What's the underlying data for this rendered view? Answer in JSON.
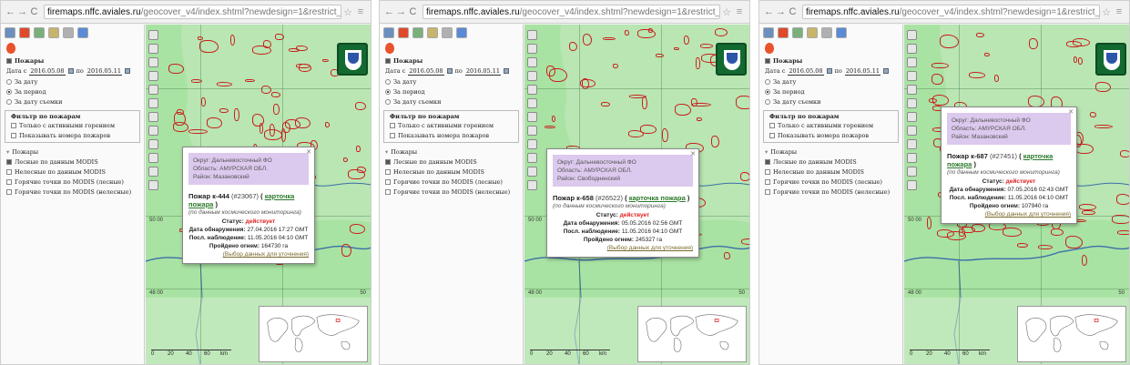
{
  "browser": {
    "url_domain": "firemaps.nffc.aviales.ru",
    "url_path": "/geocover_v4/index.shtml?newdesign=1&restrict_user=1"
  },
  "sidebar": {
    "fires_label": "Пожары",
    "date_from_label": "Дата с",
    "date_to_label": "по",
    "date_from": "2016.05.08",
    "date_to": "2016.05.11",
    "radio": [
      "За дату",
      "За период",
      "За дату съемки"
    ],
    "filter_legend": "Фильтр по пожарам",
    "filter_items": [
      "Только с активными горением",
      "Показывать номера пожаров"
    ],
    "fires_legend": "Пожары",
    "fire_items": [
      "Лесные по данным MODIS",
      "Нелесные по данным MODIS",
      "Горячие точки по MODIS (лесные)",
      "Горячие точки по MODIS (нелесные)"
    ]
  },
  "map": {
    "lat_labels": [
      "50 00",
      "48 00",
      "50"
    ],
    "scale_labels": [
      "0",
      "20",
      "40",
      "60",
      "km"
    ]
  },
  "popups": [
    {
      "region_lines": [
        "Округ: Дальневосточный ФО",
        "Область: АМУРСКАЯ ОБЛ.",
        "Район: Мазановский"
      ],
      "fire_number": "Пожар к-444",
      "fire_id": "(#23067)",
      "card_link": "карточка пожара",
      "note": "(по данным космического мониторинга)",
      "status_label": "Статус:",
      "status_value": "действует",
      "detected_label": "Дата обнаружения:",
      "detected_value": "27.04.2016 17:27 GMT",
      "last_obs_label": "Посл. наблюдение:",
      "last_obs_value": "11.05.2016 04:10 GMT",
      "area_label": "Пройдено огнем:",
      "area_value": "164730 га",
      "refine_link": "(Выбор данных для уточнения)"
    },
    {
      "region_lines": [
        "Округ: Дальневосточный ФО",
        "Область: АМУРСКАЯ ОБЛ.",
        "Район: Свободненский"
      ],
      "fire_number": "Пожар к-658",
      "fire_id": "(#26522)",
      "card_link": "карточка пожара",
      "note": "(по данным космического мониторинга)",
      "status_label": "Статус:",
      "status_value": "действует",
      "detected_label": "Дата обнаружения:",
      "detected_value": "05.05.2016 02:56 GMT",
      "last_obs_label": "Посл. наблюдение:",
      "last_obs_value": "11.05.2016 04:10 GMT",
      "area_label": "Пройдено огнем:",
      "area_value": "245327 га",
      "refine_link": "(Выбор данных для уточнения)"
    },
    {
      "region_lines": [
        "Округ: Дальневосточный ФО",
        "Область: АМУРСКАЯ ОБЛ.",
        "Район: Мазановский"
      ],
      "fire_number": "Пожар к-687",
      "fire_id": "(#27451)",
      "card_link": "карточка пожара",
      "note": "(по данным космического мониторинга)",
      "status_label": "Статус:",
      "status_value": "действует",
      "detected_label": "Дата обнаружения:",
      "detected_value": "07.05.2016 02:43 GMT",
      "last_obs_label": "Посл. наблюдение:",
      "last_obs_value": "11.05.2016 04:10 GMT",
      "area_label": "Пройдено огнем:",
      "area_value": "107940 га",
      "refine_link": "(Выбор данных для уточнения)"
    }
  ],
  "colors": {
    "forest": "#a9e3a3",
    "fire_outline": "#c91e1e",
    "region_box": "#dcc9ee",
    "status_active": "#e02020"
  }
}
